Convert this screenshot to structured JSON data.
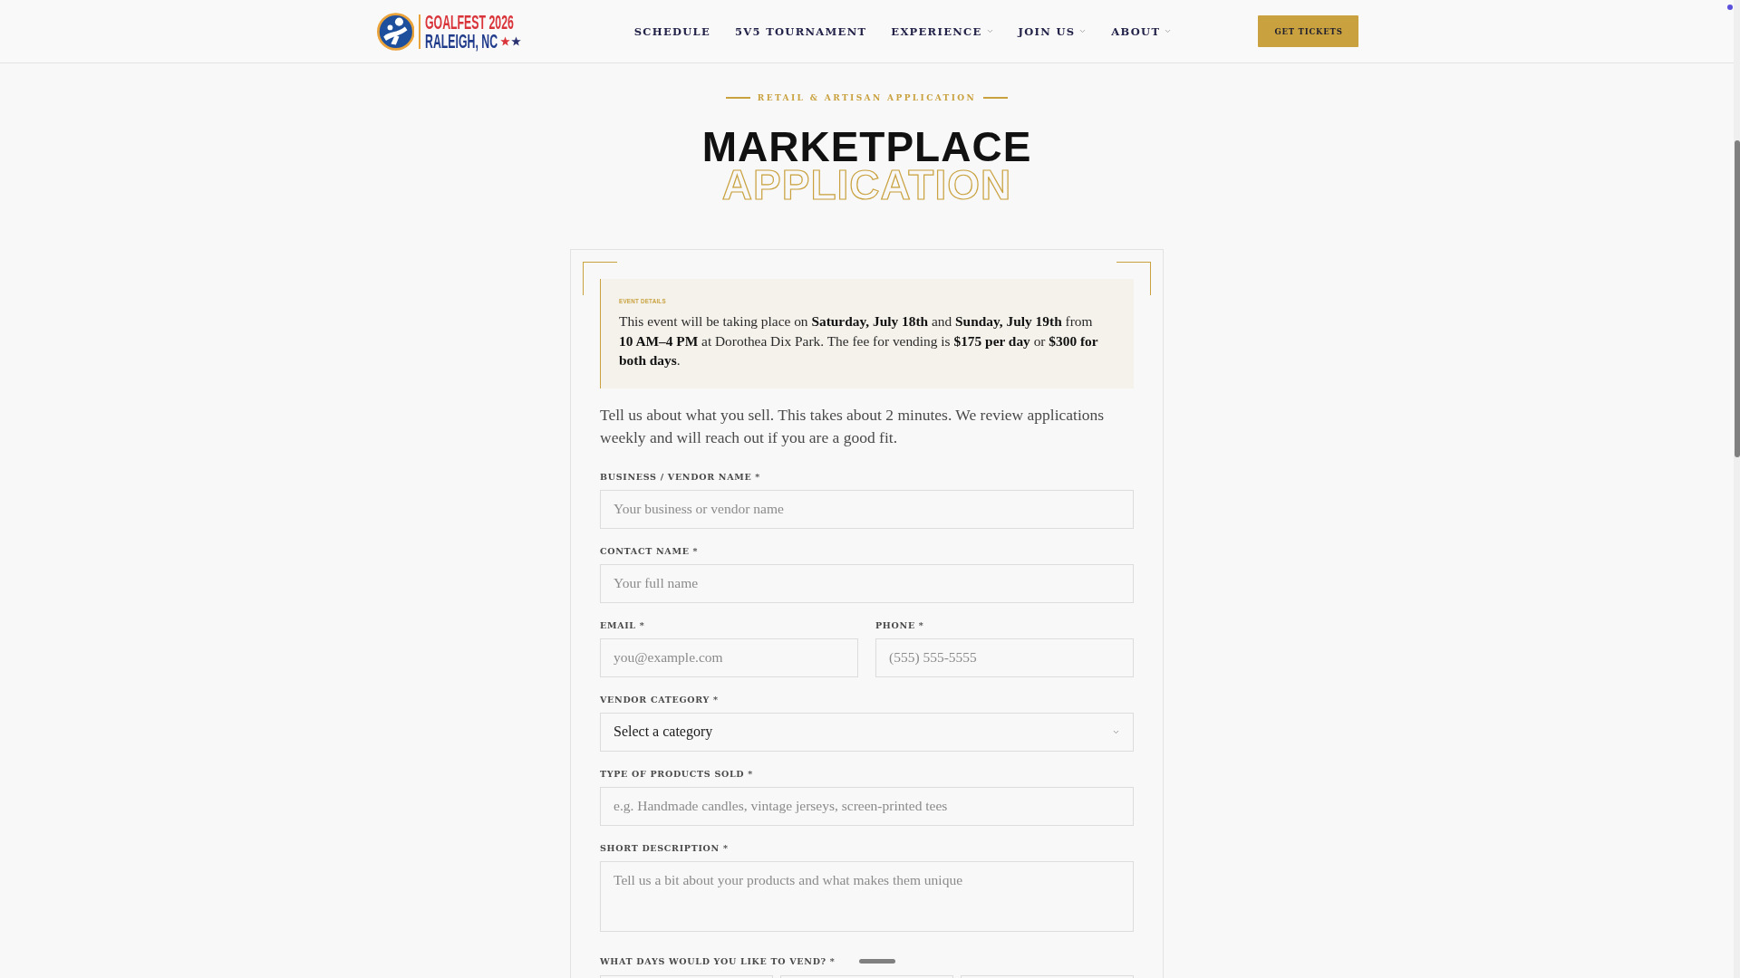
{
  "header": {
    "logo": {
      "title": "GOALFEST 2026",
      "subtitle": "RALEIGH, NC"
    },
    "nav": [
      {
        "label": "SCHEDULE",
        "has_menu": false
      },
      {
        "label": "5V5 TOURNAMENT",
        "has_menu": false
      },
      {
        "label": "EXPERIENCE",
        "has_menu": true
      },
      {
        "label": "JOIN US",
        "has_menu": true
      },
      {
        "label": "ABOUT",
        "has_menu": true
      }
    ],
    "cta": "GET TICKETS"
  },
  "hero": {
    "eyebrow": "RETAIL & ARTISAN APPLICATION",
    "title": "MARKETPLACE",
    "title_outline": "APPLICATION"
  },
  "form": {
    "event_details": {
      "heading": "EVENT DETAILS",
      "text": "This event will be taking place on **Saturday, July 18th** and **Sunday, July 19th** from **10 AM–4 PM** at Dorothea Dix Park. The fee for vending is **$175 per day** or **$300 for both days**."
    },
    "intro": "Tell us about what you sell. This takes about 2 minutes. We review applications weekly and will reach out if you are a good fit.",
    "fields": [
      {
        "kind": "text",
        "label": "BUSINESS / VENDOR NAME *",
        "placeholder": "Your business or vendor name"
      },
      {
        "kind": "text",
        "label": "CONTACT NAME *",
        "placeholder": "Your full name"
      },
      {
        "kind": "row",
        "fields": [
          {
            "kind": "text",
            "label": "EMAIL *",
            "placeholder": "you@example.com"
          },
          {
            "kind": "text",
            "label": "PHONE *",
            "placeholder": "(555) 555-5555"
          }
        ]
      },
      {
        "kind": "select",
        "label": "VENDOR CATEGORY *",
        "value": "Select a category"
      },
      {
        "kind": "text",
        "label": "TYPE OF PRODUCTS SOLD *",
        "placeholder": "e.g. Handmade candles, vintage jerseys, screen-printed tees"
      },
      {
        "kind": "textarea",
        "label": "SHORT DESCRIPTION *",
        "placeholder": "Tell us a bit about your products and what makes them unique"
      },
      {
        "kind": "choices",
        "label": "WHAT DAYS WOULD YOU LIKE TO VEND? *"
      }
    ]
  }
}
